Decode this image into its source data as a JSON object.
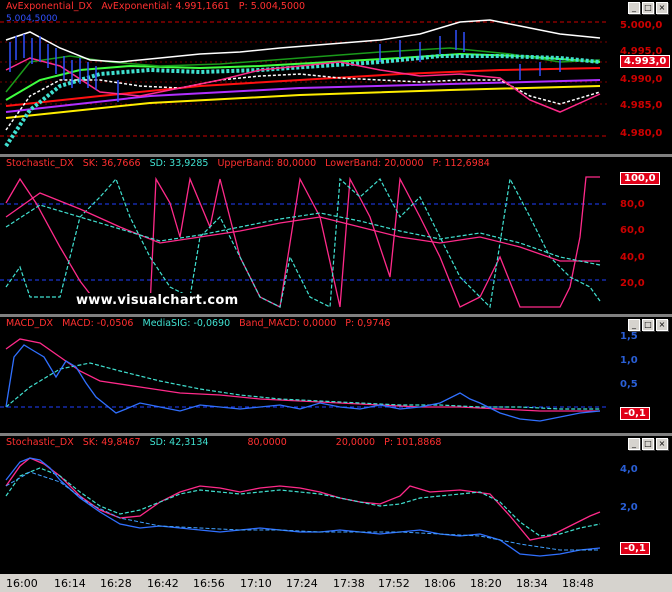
{
  "panes": [
    {
      "id": "avexp",
      "header": [
        {
          "text": "AvExponential_DX",
          "color": "#ff3030"
        },
        {
          "text": "AvExponential: 4.991,1661",
          "color": "#ff3030"
        },
        {
          "text": "P: 5.004,5000",
          "color": "#ff3030"
        }
      ],
      "ticks": [
        "5.000,0",
        "4.995,0",
        "4.990,0",
        "4.985,0",
        "4.980,0"
      ],
      "badge": "4.993,0",
      "corner_label": "5.004,5000"
    },
    {
      "id": "stoch1",
      "header": [
        {
          "text": "Stochastic_DX",
          "color": "#ff3030"
        },
        {
          "text": "SK: 36,7666",
          "color": "#ff3030"
        },
        {
          "text": "SD: 33,9285",
          "color": "#40e0d0"
        },
        {
          "text": "UpperBand: 80,0000",
          "color": "#ff3030"
        },
        {
          "text": "LowerBand: 20,0000",
          "color": "#ff3030"
        },
        {
          "text": "P: 112,6984",
          "color": "#ff3030"
        }
      ],
      "ticks": [
        "80,0",
        "60,0",
        "40,0",
        "20,0"
      ],
      "badge": "100,0"
    },
    {
      "id": "macd",
      "header": [
        {
          "text": "MACD_DX",
          "color": "#ff3030"
        },
        {
          "text": "MACD: -0,0506",
          "color": "#ff3030"
        },
        {
          "text": "MediaSIG: -0,0690",
          "color": "#40e0d0"
        },
        {
          "text": "Band_MACD: 0,0000",
          "color": "#ff3030"
        },
        {
          "text": "P: 0,9746",
          "color": "#ff3030"
        }
      ],
      "ticks": [
        "1,5",
        "1,0",
        "0,5"
      ],
      "badge": "-0,1"
    },
    {
      "id": "stoch2",
      "header": [
        {
          "text": "Stochastic_DX",
          "color": "#ff3030"
        },
        {
          "text": "SK: 49,8467",
          "color": "#ff3030"
        },
        {
          "text": "SD: 42,3134",
          "color": "#40e0d0"
        },
        {
          "text": "80,0000",
          "color": "#ff3030"
        },
        {
          "text": "20,0000",
          "color": "#ff3030"
        },
        {
          "text": "P: 101,8868",
          "color": "#ff3030"
        }
      ],
      "ticks": [
        "4,0",
        "2,0"
      ],
      "badge": "-0,1"
    }
  ],
  "time_axis": [
    "16:00",
    "16:14",
    "16:28",
    "16:42",
    "16:56",
    "17:10",
    "17:24",
    "17:38",
    "17:52",
    "18:06",
    "18:20",
    "18:34",
    "18:48"
  ],
  "watermark": "www.visualchart.com",
  "window_buttons": {
    "minimize": "_",
    "maximize": "□",
    "close": "×"
  }
}
